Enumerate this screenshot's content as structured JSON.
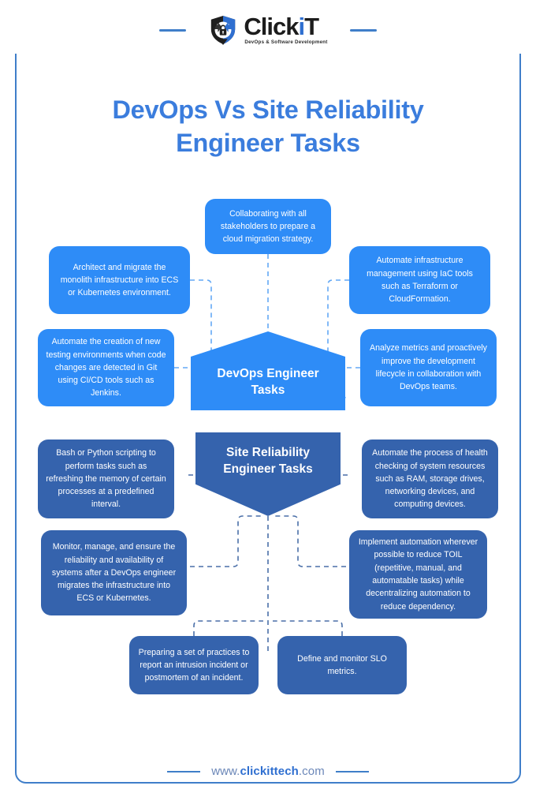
{
  "brand": {
    "logo_icon": "shield-lock-icon",
    "wordmark_prefix": "Click",
    "wordmark_accent": "i",
    "wordmark_suffix": "T",
    "wordmark_full": "ClickIT",
    "tagline": "DevOps & Software Development",
    "accent_color": "#2f6fd0",
    "frame_color": "#3f7ec9"
  },
  "title": {
    "line1": "DevOps Vs Site Reliability",
    "line2": "Engineer Tasks",
    "color": "#3b7ddd"
  },
  "devops": {
    "hub_line1": "DevOps Engineer",
    "hub_line2": "Tasks",
    "color": "#2e8cf7",
    "tasks": [
      "Collaborating with all stakeholders to prepare a cloud migration strategy.",
      "Architect and migrate the monolith infrastructure into ECS or Kubernetes environment.",
      "Automate infrastructure management using IaC tools such as Terraform or CloudFormation.",
      "Automate the creation of new testing environments when code changes are detected in Git using CI/CD tools such as Jenkins.",
      "Analyze metrics and proactively improve the development lifecycle in collaboration with DevOps teams."
    ]
  },
  "sre": {
    "hub_line1": "Site Reliability",
    "hub_line2": "Engineer Tasks",
    "color": "#3563ad",
    "tasks": [
      "Bash or Python scripting to perform tasks such as refreshing the memory of certain processes at a predefined interval.",
      "Automate the process of health checking of system resources such as RAM, storage drives, networking devices, and computing devices.",
      "Monitor, manage, and ensure the reliability and availability of systems after a DevOps engineer migrates the infrastructure into ECS or Kubernetes.",
      "Implement automation wherever possible to reduce TOIL (repetitive, manual, and automatable tasks) while decentralizing automation to reduce dependency.",
      "Preparing a set of practices to report an intrusion incident or postmortem of an incident.",
      "Define and monitor SLO metrics."
    ]
  },
  "footer": {
    "url_prefix": "www.",
    "url_brand": "clickittech",
    "url_suffix": ".com",
    "url_full": "www.clickittech.com"
  }
}
